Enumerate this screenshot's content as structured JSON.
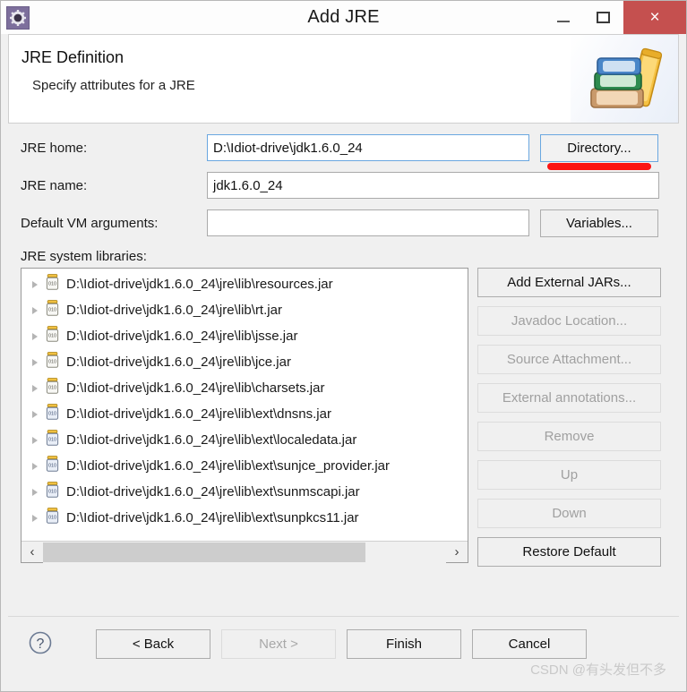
{
  "window": {
    "title": "Add JRE",
    "app_icon": "gear-icon",
    "minimize_label": "–",
    "maximize_label": "❐",
    "close_label": "×",
    "close_color": "#c5504f"
  },
  "header": {
    "title": "JRE Definition",
    "subtitle": "Specify attributes for a JRE",
    "illustration": "books-icon"
  },
  "form": {
    "jre_home": {
      "label": "JRE home:",
      "value": "D:\\Idiot-drive\\jdk1.6.0_24",
      "placeholder": "",
      "focused": true
    },
    "jre_name": {
      "label": "JRE name:",
      "value": "jdk1.6.0_24",
      "placeholder": "",
      "focused": false
    },
    "vm_args": {
      "label": "Default VM arguments:",
      "value": "",
      "placeholder": "",
      "focused": false
    },
    "directory_button": "Directory...",
    "variables_button": "Variables...",
    "annotation_color": "#fb1414"
  },
  "libraries": {
    "label": "JRE system libraries:",
    "items": [
      {
        "text": "D:\\Idiot-drive\\jdk1.6.0_24\\jre\\lib\\resources.jar",
        "icon": "jar-icon"
      },
      {
        "text": "D:\\Idiot-drive\\jdk1.6.0_24\\jre\\lib\\rt.jar",
        "icon": "jar-icon"
      },
      {
        "text": "D:\\Idiot-drive\\jdk1.6.0_24\\jre\\lib\\jsse.jar",
        "icon": "jar-icon"
      },
      {
        "text": "D:\\Idiot-drive\\jdk1.6.0_24\\jre\\lib\\jce.jar",
        "icon": "jar-icon"
      },
      {
        "text": "D:\\Idiot-drive\\jdk1.6.0_24\\jre\\lib\\charsets.jar",
        "icon": "jar-icon"
      },
      {
        "text": "D:\\Idiot-drive\\jdk1.6.0_24\\jre\\lib\\ext\\dnsns.jar",
        "icon": "jar-ext-icon"
      },
      {
        "text": "D:\\Idiot-drive\\jdk1.6.0_24\\jre\\lib\\ext\\localedata.jar",
        "icon": "jar-ext-icon"
      },
      {
        "text": "D:\\Idiot-drive\\jdk1.6.0_24\\jre\\lib\\ext\\sunjce_provider.jar",
        "icon": "jar-ext-icon"
      },
      {
        "text": "D:\\Idiot-drive\\jdk1.6.0_24\\jre\\lib\\ext\\sunmscapi.jar",
        "icon": "jar-ext-icon"
      },
      {
        "text": "D:\\Idiot-drive\\jdk1.6.0_24\\jre\\lib\\ext\\sunpkcs11.jar",
        "icon": "jar-ext-icon"
      }
    ],
    "scroll_left_label": "‹",
    "scroll_right_label": "›",
    "buttons": [
      {
        "label": "Add External JARs...",
        "enabled": true
      },
      {
        "label": "Javadoc Location...",
        "enabled": false
      },
      {
        "label": "Source Attachment...",
        "enabled": false
      },
      {
        "label": "External annotations...",
        "enabled": false
      },
      {
        "label": "Remove",
        "enabled": false
      },
      {
        "label": "Up",
        "enabled": false
      },
      {
        "label": "Down",
        "enabled": false
      },
      {
        "label": "Restore Default",
        "enabled": true
      }
    ]
  },
  "footer": {
    "help_icon": "help-circle-icon",
    "buttons": [
      {
        "label": "< Back",
        "enabled": true
      },
      {
        "label": "Next >",
        "enabled": false
      },
      {
        "label": "Finish",
        "enabled": true
      },
      {
        "label": "Cancel",
        "enabled": true
      }
    ],
    "watermark": "CSDN @有头发但不多"
  }
}
